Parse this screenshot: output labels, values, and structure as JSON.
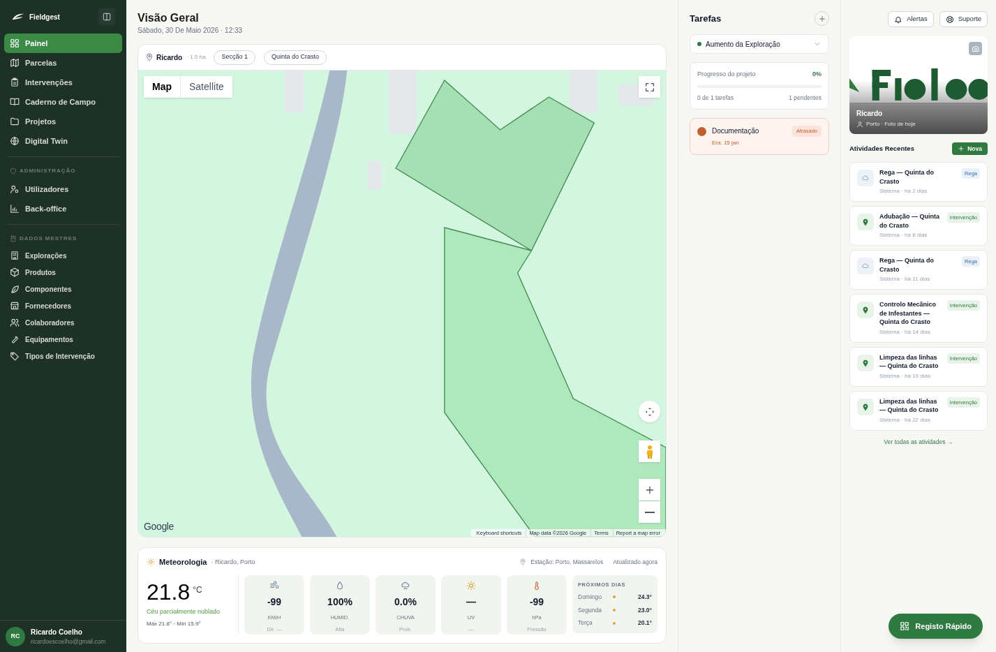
{
  "sidebar": {
    "brand": "Fieldgest",
    "sections": [
      {
        "items": [
          {
            "label": "Painel",
            "selected": true
          },
          {
            "label": "Parcelas",
            "selected": false
          },
          {
            "label": "Intervenções",
            "selected": false
          },
          {
            "label": "Caderno de Campo",
            "selected": false
          },
          {
            "label": "Projetos",
            "selected": false
          },
          {
            "label": "Digital Twin",
            "selected": false
          }
        ]
      },
      {
        "heading": "ADMINISTRAÇÃO",
        "items": [
          {
            "label": "Utilizadores",
            "selected": false
          },
          {
            "label": "Back-office",
            "selected": false
          }
        ]
      },
      {
        "heading": "DADOS MESTRES",
        "items": [
          {
            "label": "Explorações",
            "selected": false
          },
          {
            "label": "Produtos",
            "selected": false
          },
          {
            "label": "Componentes",
            "selected": false
          },
          {
            "label": "Fornecedores",
            "selected": false
          },
          {
            "label": "Colaboradores",
            "selected": false
          },
          {
            "label": "Equipamentos",
            "selected": false
          },
          {
            "label": "Tipos de Intervenção",
            "selected": false
          }
        ]
      }
    ],
    "user": {
      "initials": "RC",
      "name": "Ricardo Coelho",
      "email": "ricardoescoelho@gmail.com"
    }
  },
  "header": {
    "title": "Visão Geral",
    "subtitle": "Sábado, 30 De Maio 2026 · 12:33"
  },
  "map": {
    "location": "Ricardo",
    "area": "· 1.5 ha",
    "chips": [
      "Secção 1",
      "Quinta do Crasto"
    ],
    "map_types": [
      {
        "label": "Map",
        "selected": true
      },
      {
        "label": "Satellite",
        "selected": false
      }
    ],
    "logo": "Google",
    "attribution": [
      "Keyboard shortcuts",
      "Map data ©2026 Google",
      "Terms",
      "Report a map error"
    ]
  },
  "weather": {
    "title": "Meteorologia",
    "place": "· Ricardo, Porto",
    "station": "Estação: Porto, Massarelos",
    "updated": "Atualizado agora",
    "temperature": "21.8",
    "unit": "°C",
    "condition": "Céu parcialmente nublado",
    "range": "Máx 21.8° · Mín 15.9°",
    "metrics": [
      {
        "value": "-99",
        "unit": "KM/H",
        "caption": "Dir. —"
      },
      {
        "value": "100%",
        "unit": "HUMID.",
        "caption": "Alta"
      },
      {
        "value": "0.0%",
        "unit": "CHUVA",
        "caption": "Prob."
      },
      {
        "value": "—",
        "unit": "UV",
        "caption": "—"
      },
      {
        "value": "-99",
        "unit": "hPa",
        "caption": "Pressão"
      }
    ],
    "forecast_title": "PRÓXIMOS DIAS",
    "forecast": [
      {
        "day": "Domingo",
        "temp": "24.3°"
      },
      {
        "day": "Segunda",
        "temp": "23.0°"
      },
      {
        "day": "Terça",
        "temp": "20.1°"
      }
    ]
  },
  "tasks": {
    "title": "Tarefas",
    "project": "Aumento da Exploração",
    "progress": {
      "label": "Progresso do projeto",
      "percent": "0%",
      "level": 0,
      "done": "0 de 1 tarefas",
      "pending": "1 pendentes"
    },
    "items": [
      {
        "title": "Documentação",
        "due": "Era: 15 jan",
        "badge": "Atrasado",
        "kind": "overdue"
      }
    ]
  },
  "topbar": {
    "buttons": [
      "Alertas",
      "Suporte"
    ]
  },
  "photo": {
    "kind": "picture",
    "title": "Ricardo",
    "caption": "Porto · Foto de hoje"
  },
  "activities": {
    "title": "Atividades Recentes",
    "new_button": "Nova",
    "items": [
      {
        "title": "Rega — Quinta do Crasto",
        "meta": "Sistema · há 2 dias",
        "tag": "Rega",
        "kind": "rega"
      },
      {
        "title": "Adubação — Quinta do Crasto",
        "meta": "Sistema · há 8 dias",
        "tag": "Intervenção",
        "kind": "intervencao"
      },
      {
        "title": "Rega — Quinta do Crasto",
        "meta": "Sistema · há 11 dias",
        "tag": "Rega",
        "kind": "rega"
      },
      {
        "title": "Controlo Mecânico de Infestantes — Quinta do Crasto",
        "meta": "Sistema · há 14 dias",
        "tag": "Intervenção",
        "kind": "intervencao"
      },
      {
        "title": "Limpeza das linhas — Quinta do Crasto",
        "meta": "Sistema · há 19 dias",
        "tag": "Intervenção",
        "kind": "intervencao"
      },
      {
        "title": "Limpeza das linhas — Quinta do Crasto",
        "meta": "Sistema · há 22 dias",
        "tag": "Intervenção",
        "kind": "intervencao"
      }
    ],
    "see_all": "Ver todas as atividades →"
  },
  "quick_button": "Registo Rápido"
}
